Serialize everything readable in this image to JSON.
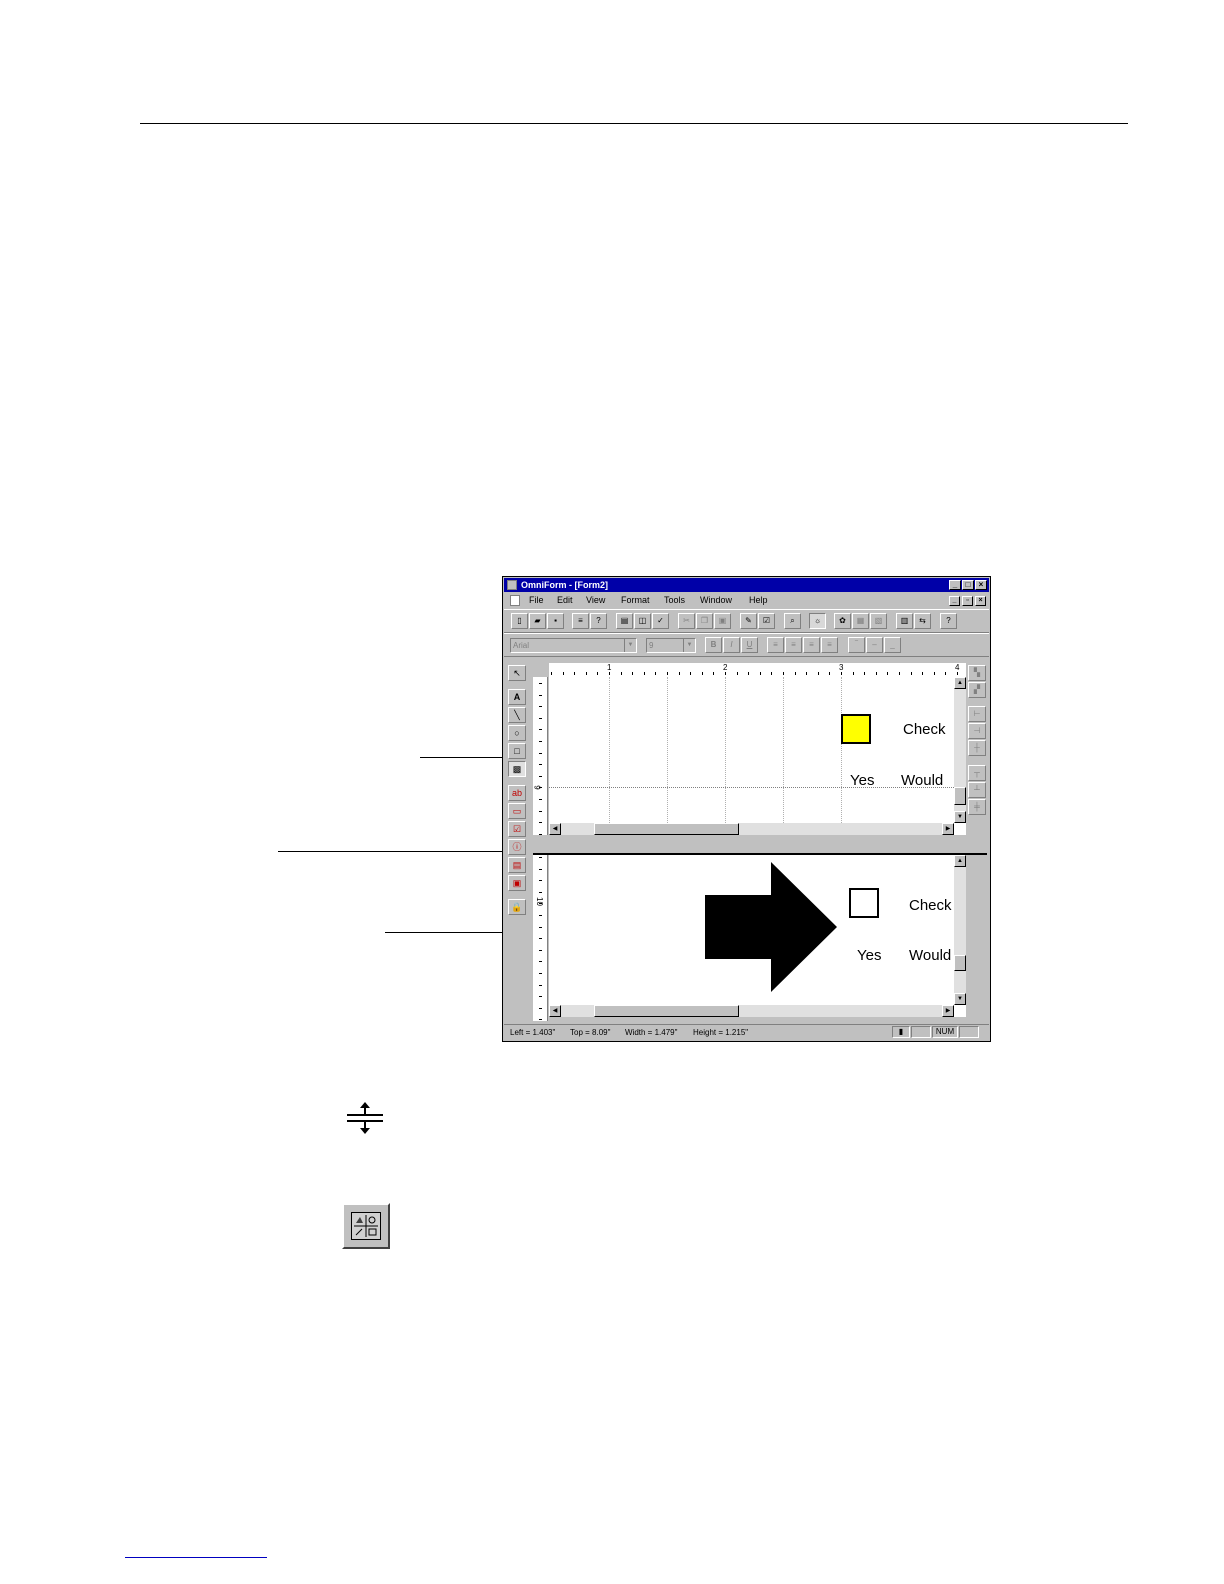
{
  "window": {
    "title": "OmniForm - [Form2]",
    "menus": [
      "File",
      "Edit",
      "View",
      "Format",
      "Tools",
      "Window",
      "Help"
    ],
    "font_combo": "Arial",
    "size_combo": "9",
    "ruler_numbers": [
      "1",
      "2",
      "3",
      "4"
    ],
    "vruler_numbers": [
      "9",
      "10"
    ]
  },
  "form_top": {
    "checkbox_label": "Check",
    "yes_label": "Yes",
    "would_label": "Would"
  },
  "form_bottom": {
    "checkbox_label": "Check",
    "yes_label": "Yes",
    "would_label": "Would"
  },
  "status": {
    "left": "Left = 1.403\"",
    "top": "Top = 8.09\"",
    "width": "Width = 1.479\"",
    "height": "Height = 1.215\"",
    "num": "NUM"
  },
  "icons": {
    "split_cursor": "split-cursor-icon",
    "split_tool": "split-window-tool-icon"
  },
  "colors": {
    "titlebar": "#0000a8",
    "checkbox_highlight": "#ffff00"
  }
}
